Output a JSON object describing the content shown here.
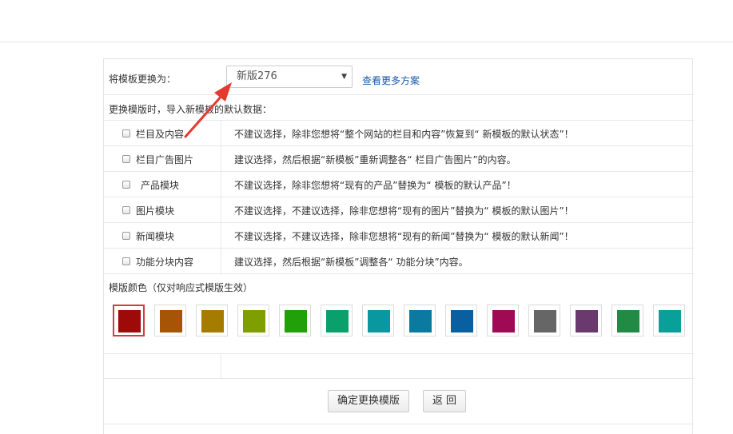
{
  "template": {
    "label": "将模板更换为：",
    "selected": "新版276",
    "more_link": "查看更多方案"
  },
  "import_header": "更换模版时，导入新模板的默认数据：",
  "options": [
    {
      "name": "栏目及内容",
      "desc": "不建议选择，除非您想将“整个网站的栏目和内容”恢复到“ 新模板的默认状态”！"
    },
    {
      "name": "栏目广告图片",
      "desc": "建议选择，然后根据“新模板”重新调整各“ 栏目广告图片”的内容。"
    },
    {
      "name": "产品模块",
      "desc": "不建议选择，除非您想将“现有的产品”替换为“ 模板的默认产品”！"
    },
    {
      "name": "图片模块",
      "desc": "不建议选择，不建议选择，除非您想将“现有的图片”替换为“ 模板的默认图片”！"
    },
    {
      "name": "新闻模块",
      "desc": "不建议选择，不建议选择，除非您想将“现有的新闻”替换为“ 模板的默认新闻”！"
    },
    {
      "name": "功能分块内容",
      "desc": "建议选择，然后根据“新模板”调整各“ 功能分块”内容。"
    }
  ],
  "color_label": "模版颜色（仅对响应式模版生效）",
  "colors": [
    "#9e0a0a",
    "#a65406",
    "#a67c00",
    "#7f9e00",
    "#22a00a",
    "#0aa06b",
    "#0a98a0",
    "#0a7aa0",
    "#0a5fa0",
    "#a00a55",
    "#666666",
    "#6a3a6e",
    "#238a46",
    "#0aa09a"
  ],
  "selected_color_index": 0,
  "buttons": {
    "confirm": "确定更换模版",
    "back": "返 回"
  }
}
